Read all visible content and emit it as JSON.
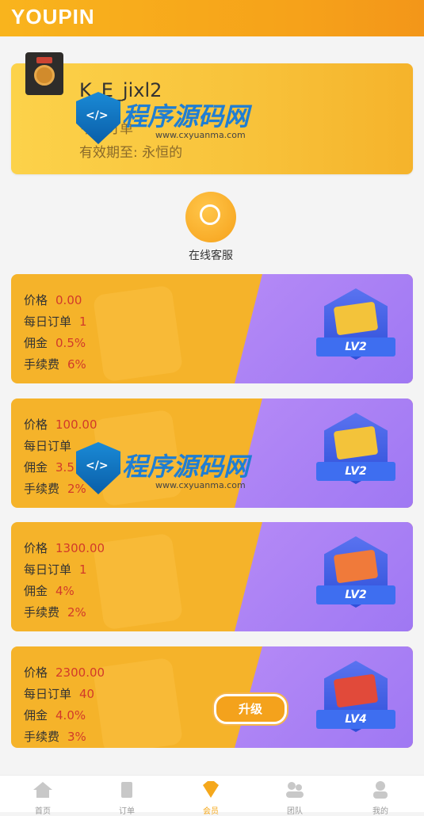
{
  "header": {
    "logo": "YOUPIN"
  },
  "member": {
    "username": "K_E_jixl2",
    "line1": "今日订单",
    "line2": "有效期至: 永恒的"
  },
  "customer_service": {
    "label": "在线客服"
  },
  "levels": [
    {
      "price_label": "价格",
      "price": "0.00",
      "orders_label": "每日订单",
      "orders": "1",
      "commission_label": "佣金",
      "commission": "0.5%",
      "fee_label": "手续费",
      "fee": "6%",
      "badge": "LV2"
    },
    {
      "price_label": "价格",
      "price": "100.00",
      "orders_label": "每日订单",
      "orders": "",
      "commission_label": "佣金",
      "commission": "3.5",
      "fee_label": "手续费",
      "fee": "2%",
      "badge": "LV2"
    },
    {
      "price_label": "价格",
      "price": "1300.00",
      "orders_label": "每日订单",
      "orders": "1",
      "commission_label": "佣金",
      "commission": "4%",
      "fee_label": "手续费",
      "fee": "2%",
      "badge": "LV2"
    },
    {
      "price_label": "价格",
      "price": "2300.00",
      "orders_label": "每日订单",
      "orders": "40",
      "commission_label": "佣金",
      "commission": "4.0%",
      "fee_label": "手续费",
      "fee": "3%",
      "badge": "LV4"
    }
  ],
  "upgrade_button": "升级",
  "tabbar": {
    "items": [
      "首页",
      "订单",
      "会员",
      "团队",
      "我的"
    ],
    "active_index": 2
  },
  "watermark": {
    "title": "程序源码网",
    "url": "www.cxyuanma.com"
  },
  "colors": {
    "accent": "#f6a21a",
    "value_red": "#d23a2a",
    "purple": "#a77ff4"
  }
}
